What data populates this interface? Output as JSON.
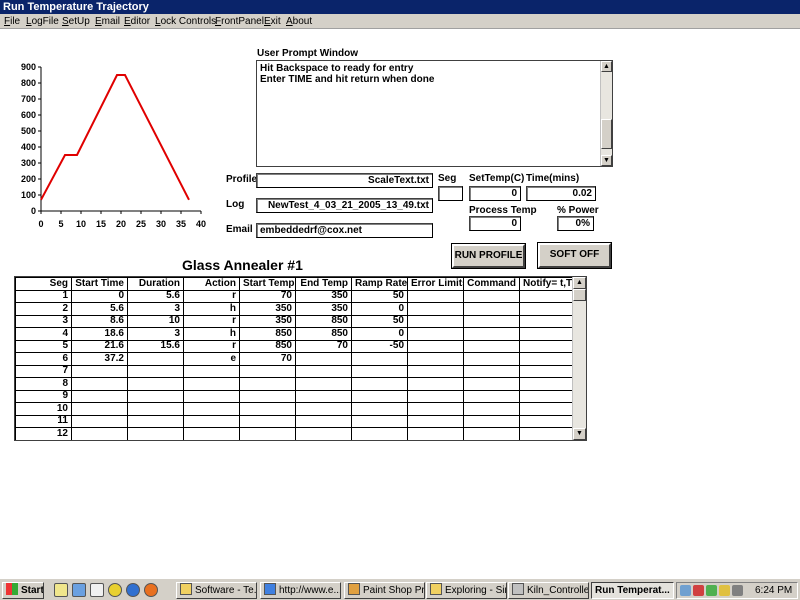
{
  "window": {
    "title": "Run Temperature Trajectory"
  },
  "menu": [
    "File",
    "LogFile",
    "SetUp",
    "Email",
    "Editor",
    "Lock Controls",
    "FrontPanel",
    "Exit",
    "About"
  ],
  "chart_data": {
    "type": "line",
    "x": [
      0,
      6,
      9,
      19,
      21,
      37
    ],
    "y": [
      70,
      350,
      350,
      850,
      850,
      70
    ],
    "xlim": [
      0,
      40
    ],
    "ylim": [
      0,
      900
    ],
    "xticks": [
      "0",
      "5",
      "10",
      "15",
      "20",
      "25",
      "30",
      "35",
      "40"
    ],
    "yticks": [
      "0",
      "100",
      "200",
      "300",
      "400",
      "500",
      "600",
      "700",
      "800",
      "900"
    ],
    "line_color": "#e00000",
    "grid": false
  },
  "prompt": {
    "label": "User Prompt Window",
    "lines": [
      "Hit Backspace to ready for entry",
      "Enter TIME and hit return when done"
    ]
  },
  "profile": {
    "label": "Profile",
    "value": "ScaleText.txt"
  },
  "log": {
    "label": "Log",
    "value": "NewTest_4_03_21_2005_13_49.txt"
  },
  "email": {
    "label": "Email",
    "value": "embeddedrf@cox.net"
  },
  "seg": {
    "label": "Seg",
    "value": ""
  },
  "settemp": {
    "label": "SetTemp(C)",
    "value": "0"
  },
  "time": {
    "label": "Time(mins)",
    "value": "0.02"
  },
  "processtemp": {
    "label": "Process Temp",
    "value": "0"
  },
  "power": {
    "label": "% Power",
    "value": "0%"
  },
  "buttons": {
    "run": "RUN PROFILE",
    "softoff": "SOFT OFF"
  },
  "table": {
    "title": "Glass Annealer #1",
    "headers": [
      "Seg",
      "Start Time",
      "Duration",
      "Action",
      "Start Temp",
      "End Temp",
      "Ramp Rate",
      "Error Limits",
      "Command",
      "Notify= t,T"
    ],
    "rows": [
      [
        "1",
        "0",
        "5.6",
        "r",
        "70",
        "350",
        "50",
        "",
        "",
        ""
      ],
      [
        "2",
        "5.6",
        "3",
        "h",
        "350",
        "350",
        "0",
        "",
        "",
        ""
      ],
      [
        "3",
        "8.6",
        "10",
        "r",
        "350",
        "850",
        "50",
        "",
        "",
        ""
      ],
      [
        "4",
        "18.6",
        "3",
        "h",
        "850",
        "850",
        "0",
        "",
        "",
        ""
      ],
      [
        "5",
        "21.6",
        "15.6",
        "r",
        "850",
        "70",
        "-50",
        "",
        "",
        ""
      ],
      [
        "6",
        "37.2",
        "",
        "e",
        "70",
        "",
        "",
        "",
        "",
        ""
      ],
      [
        "7",
        "",
        "",
        "",
        "",
        "",
        "",
        "",
        "",
        ""
      ],
      [
        "8",
        "",
        "",
        "",
        "",
        "",
        "",
        "",
        "",
        ""
      ],
      [
        "9",
        "",
        "",
        "",
        "",
        "",
        "",
        "",
        "",
        ""
      ],
      [
        "10",
        "",
        "",
        "",
        "",
        "",
        "",
        "",
        "",
        ""
      ],
      [
        "11",
        "",
        "",
        "",
        "",
        "",
        "",
        "",
        "",
        ""
      ],
      [
        "12",
        "",
        "",
        "",
        "",
        "",
        "",
        "",
        "",
        ""
      ]
    ]
  },
  "taskbar": {
    "start": "Start",
    "tasks": [
      "Software - Te...",
      "http://www.e...",
      "Paint Shop Pr...",
      "Exploring - Sin...",
      "Kiln_Controller...",
      "Run Temperat..."
    ],
    "clock": "6:24 PM"
  }
}
